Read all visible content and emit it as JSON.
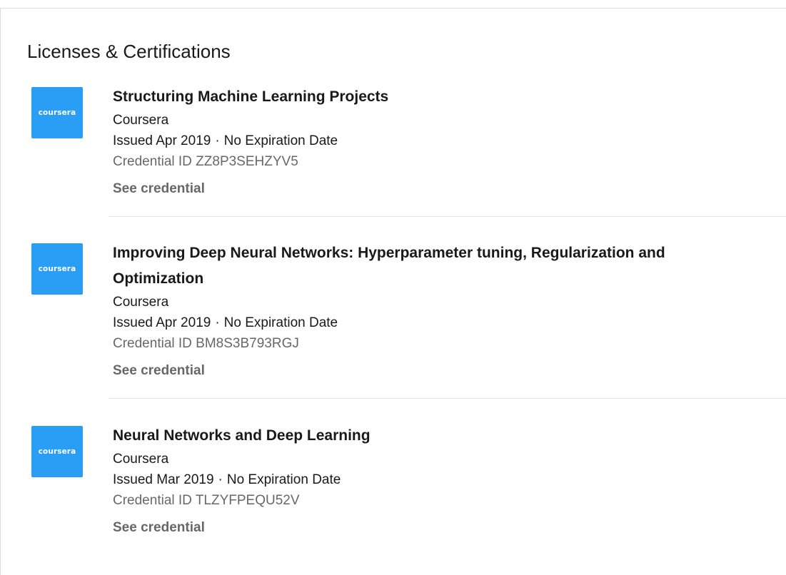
{
  "section": {
    "title": "Licenses & Certifications"
  },
  "certifications": [
    {
      "logo_text": "coursera",
      "title": "Structuring Machine Learning Projects",
      "issuer": "Coursera",
      "issued": "Issued Apr 2019",
      "separator": "·",
      "expiration": "No Expiration Date",
      "credential_id": "Credential ID ZZ8P3SEHZYV5",
      "link_label": "See credential"
    },
    {
      "logo_text": "coursera",
      "title": "Improving Deep Neural Networks: Hyperparameter tuning, Regularization and Optimization",
      "issuer": "Coursera",
      "issued": "Issued Apr 2019",
      "separator": "·",
      "expiration": "No Expiration Date",
      "credential_id": "Credential ID BM8S3B793RGJ",
      "link_label": "See credential"
    },
    {
      "logo_text": "coursera",
      "title": "Neural Networks and Deep Learning",
      "issuer": "Coursera",
      "issued": "Issued Mar 2019",
      "separator": "·",
      "expiration": "No Expiration Date",
      "credential_id": "Credential ID TLZYFPEQU52V",
      "link_label": "See credential"
    }
  ],
  "colors": {
    "logo_background": "#2a9df4",
    "primary_text": "#1a1a1a",
    "secondary_text": "#666666",
    "divider": "#e4e4e4"
  }
}
